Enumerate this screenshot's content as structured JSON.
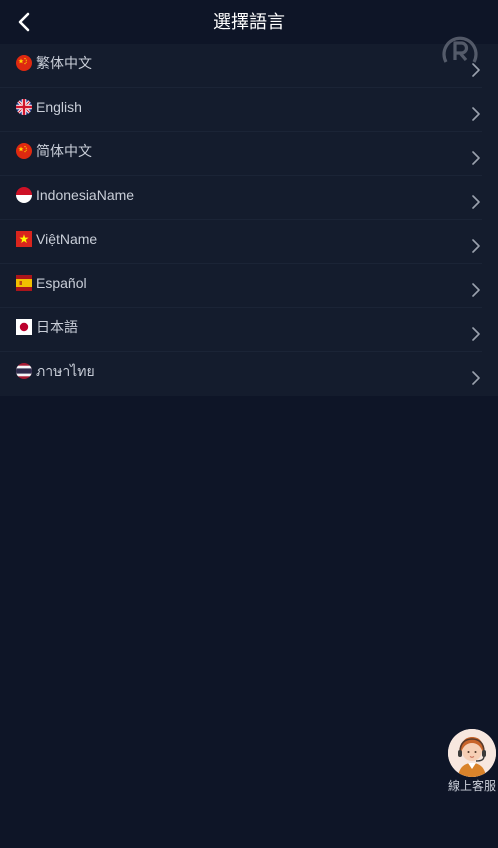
{
  "header": {
    "title": "選擇語言",
    "back_icon": "chevron-left-icon"
  },
  "languages": [
    {
      "label": "繁体中文",
      "flag": "china-flag-icon"
    },
    {
      "label": "English",
      "flag": "uk-flag-icon"
    },
    {
      "label": "简体中文",
      "flag": "china-flag-icon"
    },
    {
      "label": "IndonesiaName",
      "flag": "indonesia-flag-icon"
    },
    {
      "label": "ViệtName",
      "flag": "vietnam-flag-icon"
    },
    {
      "label": "Español",
      "flag": "spain-flag-icon"
    },
    {
      "label": "日本語",
      "flag": "japan-flag-icon"
    },
    {
      "label": "ภาษาไทย",
      "flag": "thailand-flag-icon"
    }
  ],
  "support": {
    "label": "線上客服",
    "icon": "customer-service-avatar-icon"
  },
  "colors": {
    "background": "#0e1527",
    "list_background": "#141c2d",
    "text": "#c9ced8",
    "title": "#ffffff"
  }
}
